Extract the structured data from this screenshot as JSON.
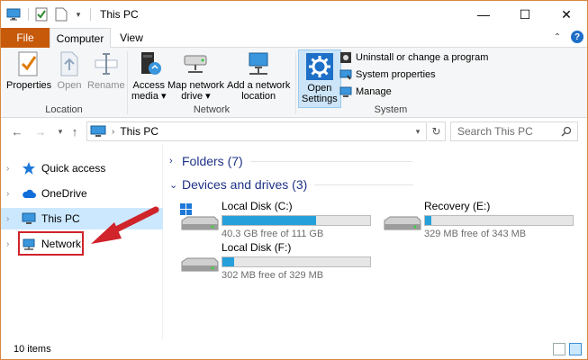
{
  "window": {
    "title": "This PC",
    "controls": {
      "minimize": "—",
      "maximize": "☐",
      "close": "✕"
    }
  },
  "ribbon": {
    "tabs": {
      "file": "File",
      "computer": "Computer",
      "view": "View"
    },
    "help_label": "?",
    "groups": {
      "location": {
        "label": "Location",
        "buttons": [
          "Properties",
          "Open",
          "Rename"
        ]
      },
      "network": {
        "label": "Network",
        "access_media": [
          "Access",
          "media ▾"
        ],
        "map_network_drive": [
          "Map network",
          "drive ▾"
        ],
        "add_network_location": [
          "Add a network",
          "location"
        ]
      },
      "system": {
        "label": "System",
        "open_settings": [
          "Open",
          "Settings"
        ],
        "small_items": [
          "Uninstall or change a program",
          "System properties",
          "Manage"
        ]
      }
    }
  },
  "address": {
    "breadcrumb": "This PC",
    "search_placeholder": "Search This PC"
  },
  "nav_pane": {
    "items": [
      {
        "label": "Quick access",
        "icon": "star-icon",
        "selected": false
      },
      {
        "label": "OneDrive",
        "icon": "cloud-icon",
        "selected": false
      },
      {
        "label": "This PC",
        "icon": "computer-icon",
        "selected": true
      },
      {
        "label": "Network",
        "icon": "network-icon",
        "selected": false
      }
    ]
  },
  "content": {
    "folders_header": "Folders (7)",
    "devices_header": "Devices and drives (3)",
    "drives": [
      {
        "name": "Local Disk (C:)",
        "free_text": "40.3 GB free of 111 GB",
        "used_fraction": 0.637,
        "system_drive": true
      },
      {
        "name": "Recovery (E:)",
        "free_text": "329 MB free of 343 MB",
        "used_fraction": 0.041,
        "system_drive": false
      },
      {
        "name": "Local Disk (F:)",
        "free_text": "302 MB free of 329 MB",
        "used_fraction": 0.082,
        "system_drive": false
      }
    ]
  },
  "status": {
    "item_count": "10 items"
  },
  "colors": {
    "file_tab": "#c6590a",
    "selection": "#cce8ff",
    "progress": "#26a0da",
    "section_header": "#1e3287",
    "annotation_red": "#d0232a"
  }
}
